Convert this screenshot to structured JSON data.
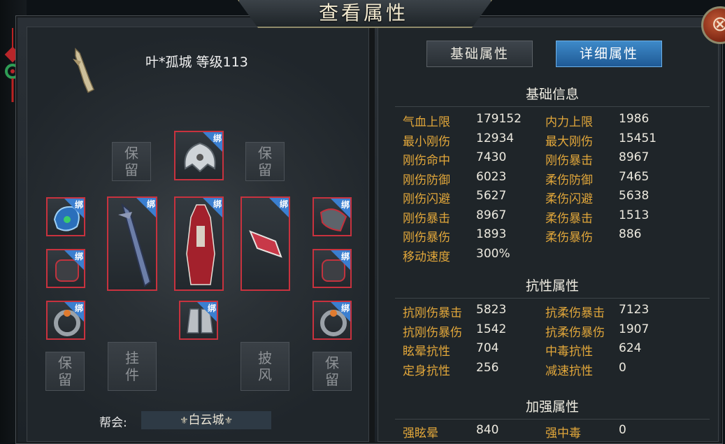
{
  "window": {
    "title": "查看属性",
    "close_label": "⊗"
  },
  "character": {
    "name_level": "叶*孤城 等级113",
    "guild_label": "帮会:",
    "guild_name": "白云城"
  },
  "slots": {
    "bind_label": "绑",
    "reserve_label": "保留",
    "pendant_label": "挂件",
    "cape_label": "披风"
  },
  "tabs": {
    "basic": "基础属性",
    "detail": "详细属性"
  },
  "sections": {
    "basic_info": "基础信息",
    "resistance": "抗性属性",
    "enhance": "加强属性"
  },
  "basic_stats": [
    {
      "k1": "气血上限",
      "v1": "179152",
      "k2": "内力上限",
      "v2": "1986"
    },
    {
      "k1": "最小刚伤",
      "v1": "12934",
      "k2": "最大刚伤",
      "v2": "15451"
    },
    {
      "k1": "刚伤命中",
      "v1": "7430",
      "k2": "刚伤暴击",
      "v2": "8967"
    },
    {
      "k1": "刚伤防御",
      "v1": "6023",
      "k2": "柔伤防御",
      "v2": "7465"
    },
    {
      "k1": "刚伤闪避",
      "v1": "5627",
      "k2": "柔伤闪避",
      "v2": "5638"
    },
    {
      "k1": "刚伤暴击",
      "v1": "8967",
      "k2": "柔伤暴击",
      "v2": "1513"
    },
    {
      "k1": "刚伤暴伤",
      "v1": "1893",
      "k2": "柔伤暴伤",
      "v2": "886"
    },
    {
      "k1": "移动速度",
      "v1": "300%",
      "k2": "",
      "v2": ""
    }
  ],
  "resist_stats": [
    {
      "k1": "抗刚伤暴击",
      "v1": "5823",
      "k2": "抗柔伤暴击",
      "v2": "7123"
    },
    {
      "k1": "抗刚伤暴伤",
      "v1": "1542",
      "k2": "抗柔伤暴伤",
      "v2": "1907"
    },
    {
      "k1": "眩晕抗性",
      "v1": "704",
      "k2": "中毒抗性",
      "v2": "624"
    },
    {
      "k1": "定身抗性",
      "v1": "256",
      "k2": "减速抗性",
      "v2": "0"
    }
  ],
  "enhance_stats": [
    {
      "k1": "强眩晕",
      "v1": "840",
      "k2": "强中毒",
      "v2": "0"
    }
  ],
  "colors": {
    "stat_key": "#e2a73a",
    "stat_value": "#ece9df",
    "slot_border": "#c8323e",
    "bind_badge": "#3b7fd0",
    "active_tab": "#2f74b3"
  }
}
